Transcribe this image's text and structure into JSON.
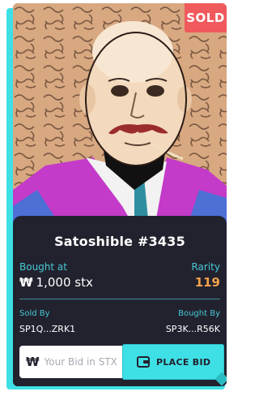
{
  "badge": {
    "label": "SOLD",
    "color": "#f05a5c"
  },
  "nft": {
    "title": "Satoshible #3435",
    "bought_at_label": "Bought at",
    "price_icon": "stx-icon",
    "price": "1,000 stx",
    "rarity_label": "Rarity",
    "rarity_value": "119",
    "sold_by_label": "Sold By",
    "sold_by_value": "SP1Q...ZRK1",
    "bought_by_label": "Bought By",
    "bought_by_value": "SP3K...R56K"
  },
  "bid": {
    "placeholder": "Your Bid in STX",
    "button_label": "PLACE BID",
    "button_icon": "wallet-icon"
  },
  "colors": {
    "accent": "#3ee0e6",
    "card_bg": "#22222f",
    "label": "#46c9d3",
    "rarity": "#f2a24a"
  }
}
